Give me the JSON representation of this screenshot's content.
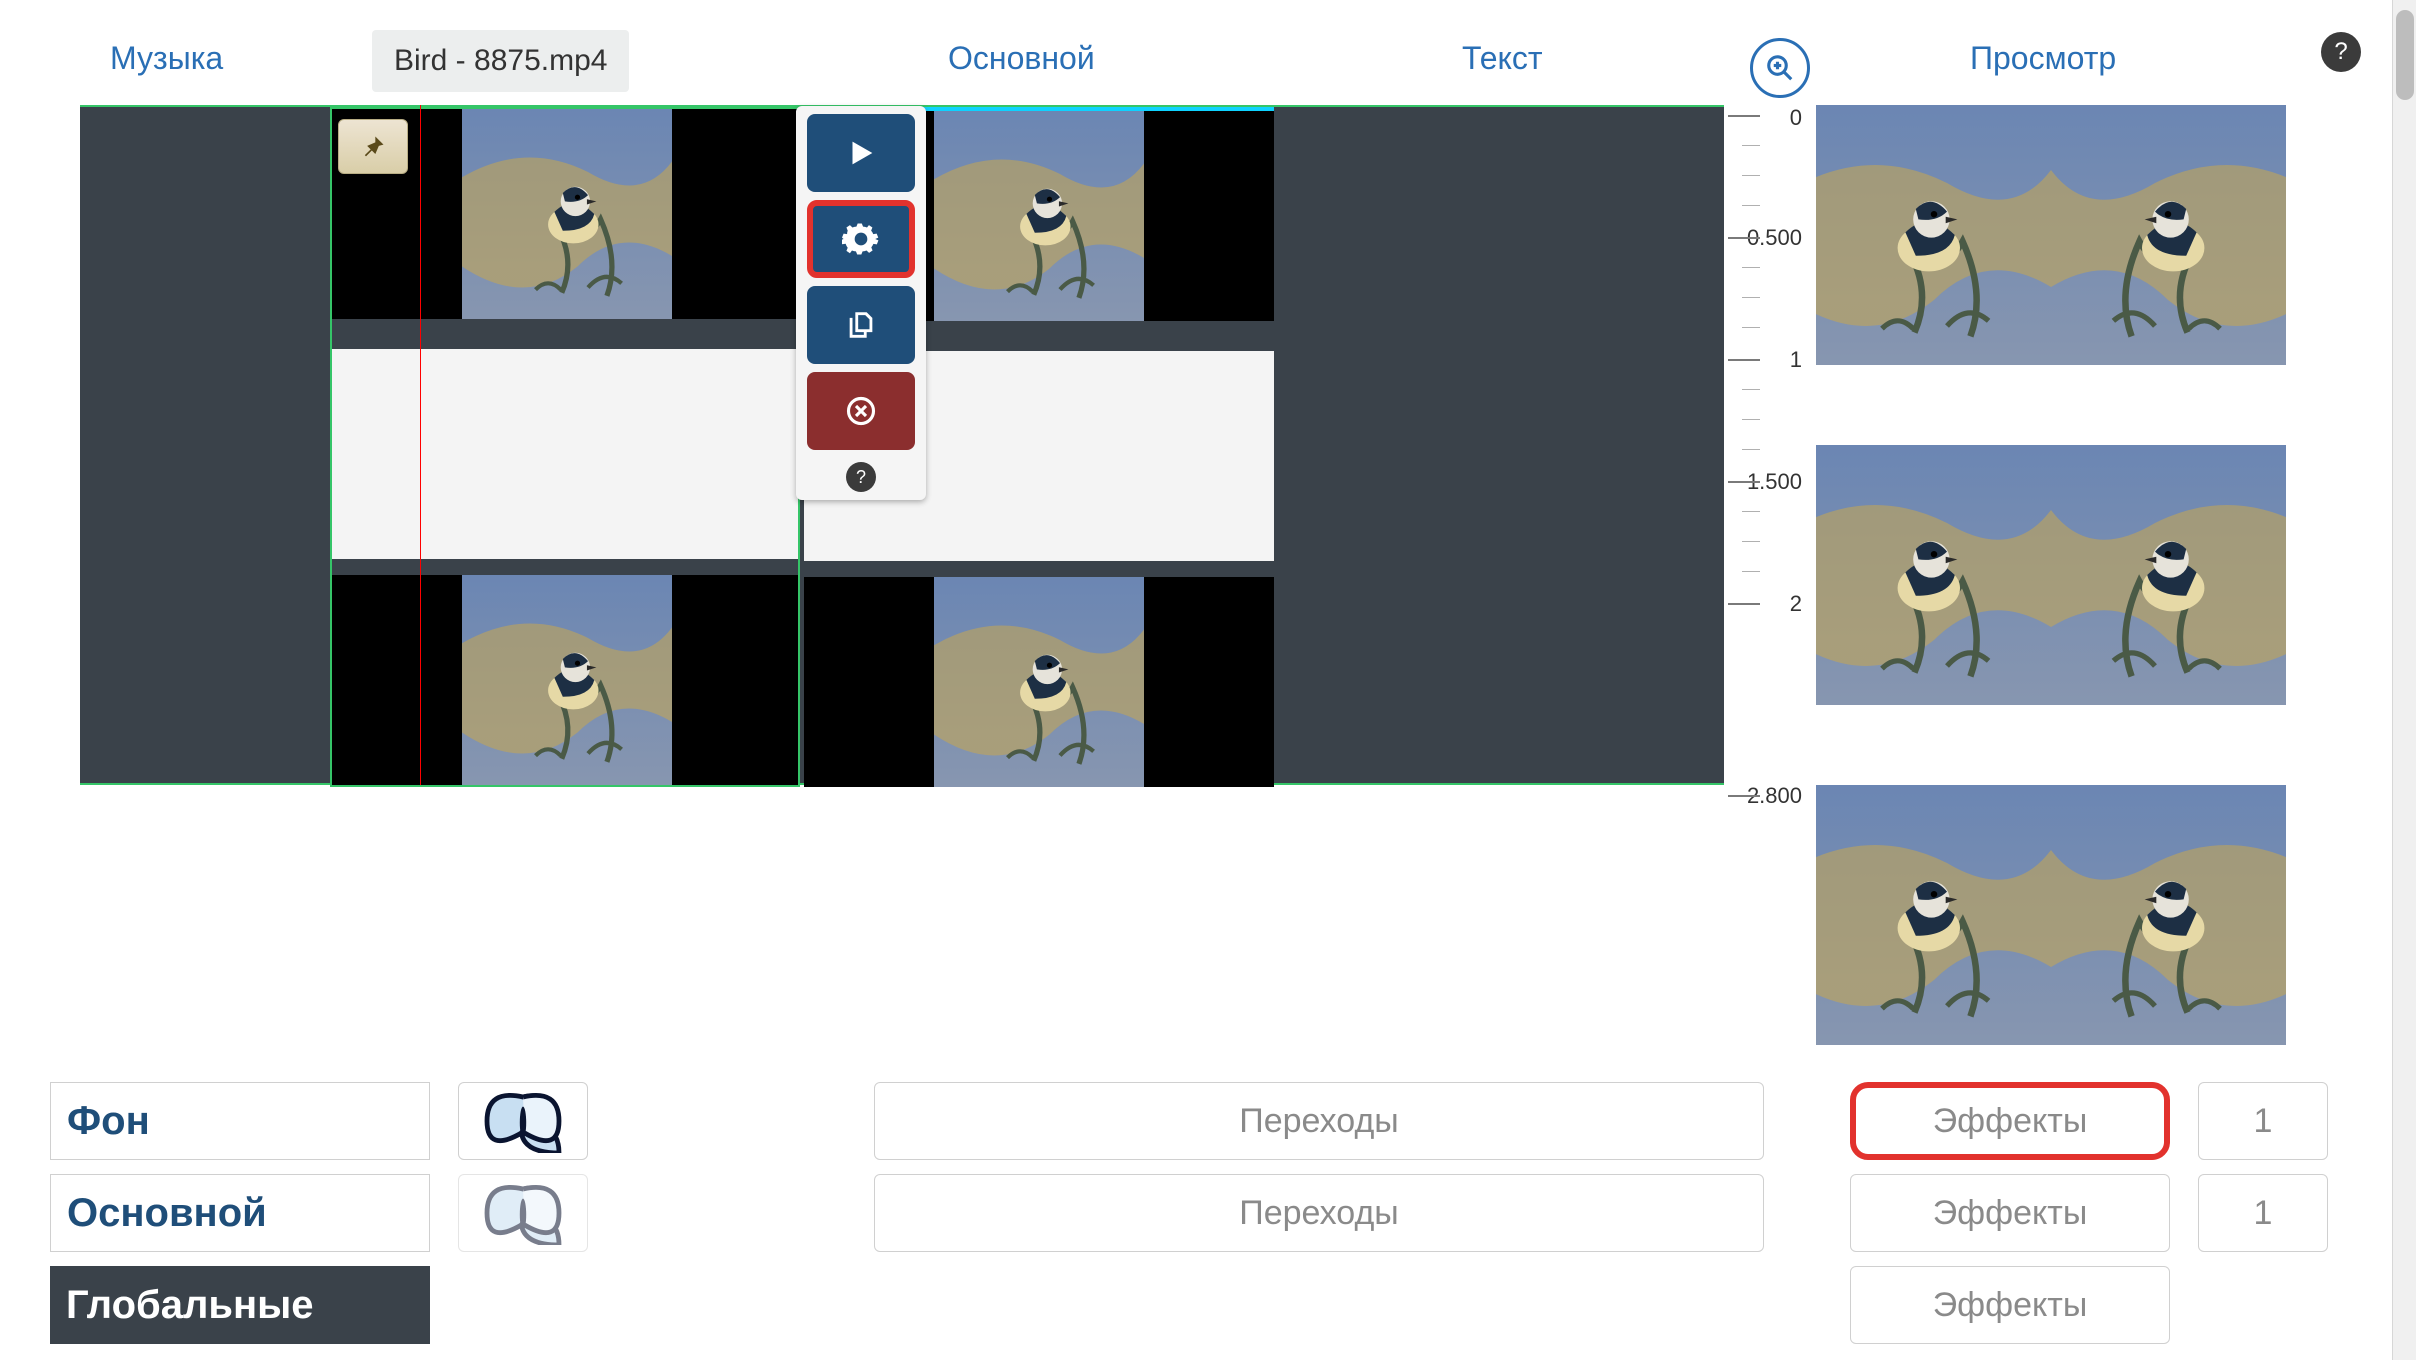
{
  "tabs": {
    "music": "Музыка",
    "main": "Основной",
    "text": "Текст",
    "preview": "Просмотр"
  },
  "current_file": "Bird - 8875.mp4",
  "ruler_marks": [
    "0",
    "0.500",
    "1",
    "1.500",
    "2",
    "2.800"
  ],
  "clip_panel": {
    "play": "play-icon",
    "gear": "gear-icon",
    "copy": "copy-icon",
    "delete": "delete-icon",
    "help": "?"
  },
  "layers": [
    {
      "name": "Фон",
      "transitions": "Переходы",
      "effects": "Эффекты",
      "count": "1",
      "has_thumb": true,
      "fx_highlight": true
    },
    {
      "name": "Основной",
      "transitions": "Переходы",
      "effects": "Эффекты",
      "count": "1",
      "has_thumb": true,
      "fx_highlight": false
    },
    {
      "name": "Глобальные",
      "effects": "Эффекты",
      "global": true
    }
  ],
  "help_label": "?"
}
